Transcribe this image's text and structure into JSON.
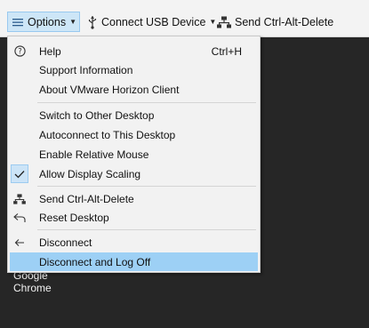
{
  "toolbar": {
    "options_label": "Options",
    "usb_label": "Connect USB Device",
    "cad_label": "Send Ctrl-Alt-Delete"
  },
  "desktop": {
    "icon_label_line1": "Google",
    "icon_label_line2": "Chrome"
  },
  "menu": {
    "items": [
      {
        "label": "Help",
        "shortcut": "Ctrl+H",
        "icon": "help-circle-icon"
      },
      {
        "label": "Support Information"
      },
      {
        "label": "About VMware Horizon Client"
      },
      {
        "label": "Switch to Other Desktop"
      },
      {
        "label": "Autoconnect to This Desktop"
      },
      {
        "label": "Enable Relative Mouse"
      },
      {
        "label": "Allow Display Scaling",
        "checked": true,
        "icon": "checkmark-icon"
      },
      {
        "label": "Send Ctrl-Alt-Delete",
        "icon": "network-icon"
      },
      {
        "label": "Reset Desktop",
        "icon": "reset-icon"
      },
      {
        "label": "Disconnect",
        "icon": "arrow-left-icon"
      },
      {
        "label": "Disconnect and Log Off",
        "highlighted": true
      }
    ]
  },
  "colors": {
    "desktop_bg": "#262626",
    "menu_bg": "#f2f2f2",
    "highlight": "#9dd0f5",
    "check_bg": "#cce4f7",
    "options_button_bg": "#cde6f7"
  }
}
